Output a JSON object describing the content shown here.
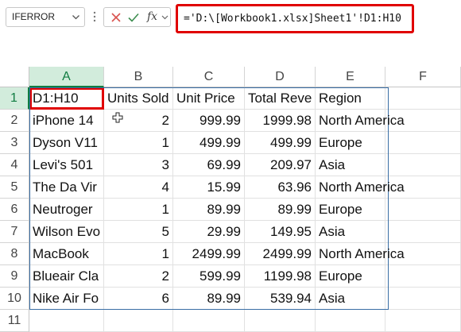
{
  "formula_bar": {
    "name_box": "IFERROR",
    "formula": "='D:\\[Workbook1.xlsx]Sheet1'!D1:H10",
    "fx_label": "fx"
  },
  "icons": {
    "name_box_dropdown": "chevron-down-icon",
    "more": "vertical-dots-icon",
    "cancel": "close-icon",
    "enter": "check-icon",
    "function": "fx-icon",
    "fx_dropdown": "chevron-down-icon",
    "cursor": "plus-cursor-icon"
  },
  "colors": {
    "highlight_red": "#e00000",
    "header_selected_green": "#107c41",
    "range_border": "#3a6ea5"
  },
  "grid": {
    "columns": [
      "A",
      "B",
      "C",
      "D",
      "E",
      "F"
    ],
    "rows": [
      "1",
      "2",
      "3",
      "4",
      "5",
      "6",
      "7",
      "8",
      "9",
      "10",
      "11"
    ],
    "cells": [
      [
        "D1:H10",
        "Units Sold",
        "Unit Price",
        "Total Reve",
        "Region",
        ""
      ],
      [
        "iPhone 14",
        "2",
        "999.99",
        "1999.98",
        "North America",
        ""
      ],
      [
        "Dyson V11",
        "1",
        "499.99",
        "499.99",
        "Europe",
        ""
      ],
      [
        "Levi's 501",
        "3",
        "69.99",
        "209.97",
        "Asia",
        ""
      ],
      [
        "The Da Vir",
        "4",
        "15.99",
        "63.96",
        "North America",
        ""
      ],
      [
        "Neutroger",
        "1",
        "89.99",
        "89.99",
        "Europe",
        ""
      ],
      [
        "Wilson Evo",
        "5",
        "29.99",
        "149.95",
        "Asia",
        ""
      ],
      [
        "MacBook",
        "1",
        "2499.99",
        "2499.99",
        "North America",
        ""
      ],
      [
        "Blueair Cla",
        "2",
        "599.99",
        "1199.98",
        "Europe",
        ""
      ],
      [
        "Nike Air Fo",
        "6",
        "89.99",
        "539.94",
        "Asia",
        ""
      ],
      [
        "",
        "",
        "",
        "",
        "",
        ""
      ]
    ]
  }
}
